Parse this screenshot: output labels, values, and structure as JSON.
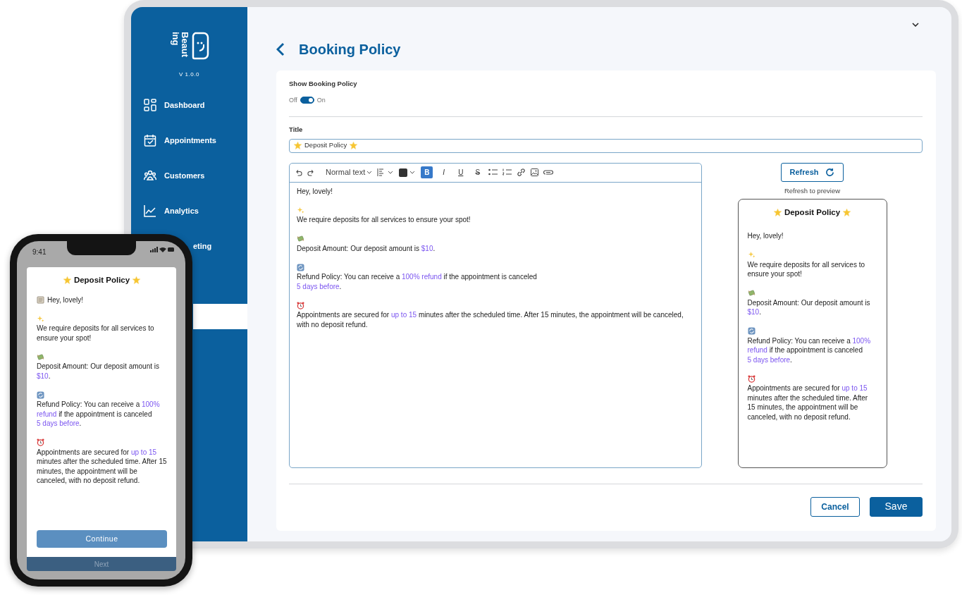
{
  "sidebar": {
    "logo_text": [
      "Beaut",
      "ing"
    ],
    "version": "V 1.0.0",
    "items": [
      {
        "label": "Dashboard",
        "kind": "full",
        "selected": false
      },
      {
        "label": "Appointments",
        "kind": "full",
        "selected": false
      },
      {
        "label": "Customers",
        "kind": "full",
        "selected": false
      },
      {
        "label": "Analytics",
        "kind": "full",
        "selected": false
      },
      {
        "label": "eting",
        "kind": "clipped",
        "selected": false
      },
      {
        "kind": "clipped",
        "selected": true
      }
    ]
  },
  "header": {
    "title": "Booking Policy"
  },
  "show_policy": {
    "label": "Show Booking Policy",
    "off_label": "Off",
    "on_label": "On",
    "on": true
  },
  "title_field": {
    "label": "Title",
    "value": "Deposit Policy"
  },
  "editor": {
    "block_style": "Normal text",
    "formats": [
      {
        "label": "B",
        "selected": true
      },
      {
        "label": "I",
        "selected": false
      },
      {
        "label": "U",
        "selected": false
      },
      {
        "label": "S",
        "selected": false
      }
    ],
    "content": [
      {
        "kind": "plain",
        "runs": [
          {
            "text": "Hey, lovely!",
            "highlight": false
          }
        ]
      },
      {
        "kind": "icon-above",
        "runs": [
          {
            "text": "We require deposits for all services to ensure your spot!",
            "highlight": false
          }
        ]
      },
      {
        "kind": "icon-above",
        "runs": [
          {
            "text": "Deposit Amount: Our deposit amount is ",
            "highlight": false
          },
          {
            "text": "$10",
            "highlight": true
          },
          {
            "text": ".",
            "highlight": false
          }
        ]
      },
      {
        "kind": "icon-above",
        "runs": [
          {
            "text": "Refund Policy: You can receive a ",
            "highlight": false
          },
          {
            "text": "100% refund",
            "highlight": true
          },
          {
            "text": " if the appointment is canceled\n",
            "highlight": false
          },
          {
            "text": "5 days before",
            "highlight": true
          },
          {
            "text": ".",
            "highlight": false
          }
        ]
      },
      {
        "kind": "icon-above",
        "runs": [
          {
            "text": "Appointments are secured for ",
            "highlight": false
          },
          {
            "text": "up to 15",
            "highlight": true
          },
          {
            "text": " minutes after the scheduled time. After 15 minutes, the appointment will be canceled, with no deposit refund.",
            "highlight": false
          }
        ]
      }
    ]
  },
  "preview": {
    "refresh_button": "Refresh",
    "hint": "Refresh to preview",
    "title": "Deposit Policy",
    "content": [
      {
        "kind": "plain",
        "runs": [
          {
            "text": "Hey, lovely!",
            "highlight": false
          }
        ]
      },
      {
        "kind": "icon-above",
        "runs": [
          {
            "text": "We require deposits for all services to ensure your spot!",
            "highlight": false
          }
        ]
      },
      {
        "kind": "icon-above",
        "runs": [
          {
            "text": "Deposit Amount: Our deposit amount is ",
            "highlight": false
          },
          {
            "text": "$10",
            "highlight": true
          },
          {
            "text": ".",
            "highlight": false
          }
        ]
      },
      {
        "kind": "icon-above",
        "runs": [
          {
            "text": "Refund Policy: You can receive a ",
            "highlight": false
          },
          {
            "text": "100% refund",
            "highlight": true
          },
          {
            "text": " if the appointment is canceled\n",
            "highlight": false
          },
          {
            "text": "5 days before",
            "highlight": true
          },
          {
            "text": ".",
            "highlight": false
          }
        ]
      },
      {
        "kind": "icon-above",
        "runs": [
          {
            "text": "Appointments are secured for ",
            "highlight": false
          },
          {
            "text": "up to 15",
            "highlight": true
          },
          {
            "text": " minutes after the scheduled time. After 15 minutes, the appointment will be canceled, with no deposit refund.",
            "highlight": false
          }
        ]
      }
    ]
  },
  "actions": [
    {
      "label": "Cancel",
      "kind": "outline"
    },
    {
      "label": "Save",
      "kind": "primary"
    }
  ],
  "phone": {
    "time": "9:41",
    "title": "Deposit Policy",
    "content": [
      {
        "kind": "inline-icon",
        "runs": [
          {
            "text": "Hey, lovely!",
            "highlight": false
          }
        ]
      },
      {
        "kind": "icon-above",
        "runs": [
          {
            "text": "We require deposits for all services to ensure your spot!",
            "highlight": false
          }
        ]
      },
      {
        "kind": "icon-above",
        "runs": [
          {
            "text": "Deposit Amount: Our deposit amount is ",
            "highlight": false
          },
          {
            "text": "$10",
            "highlight": true
          },
          {
            "text": ".",
            "highlight": false
          }
        ]
      },
      {
        "kind": "icon-above",
        "runs": [
          {
            "text": "Refund Policy: You can receive a ",
            "highlight": false
          },
          {
            "text": "100% refund",
            "highlight": true
          },
          {
            "text": " if the appointment is canceled\n",
            "highlight": false
          },
          {
            "text": "5 days before",
            "highlight": true
          },
          {
            "text": ".",
            "highlight": false
          }
        ]
      },
      {
        "kind": "icon-above",
        "runs": [
          {
            "text": "Appointments are secured for ",
            "highlight": false
          },
          {
            "text": "up to 15",
            "highlight": true
          },
          {
            "text": " minutes after the scheduled time. After 15 minutes, the appointment will be canceled, with no deposit refund.",
            "highlight": false
          }
        ]
      }
    ],
    "continue_button": "Continue",
    "next_button": {
      "label": "Next",
      "disabled": true
    }
  }
}
